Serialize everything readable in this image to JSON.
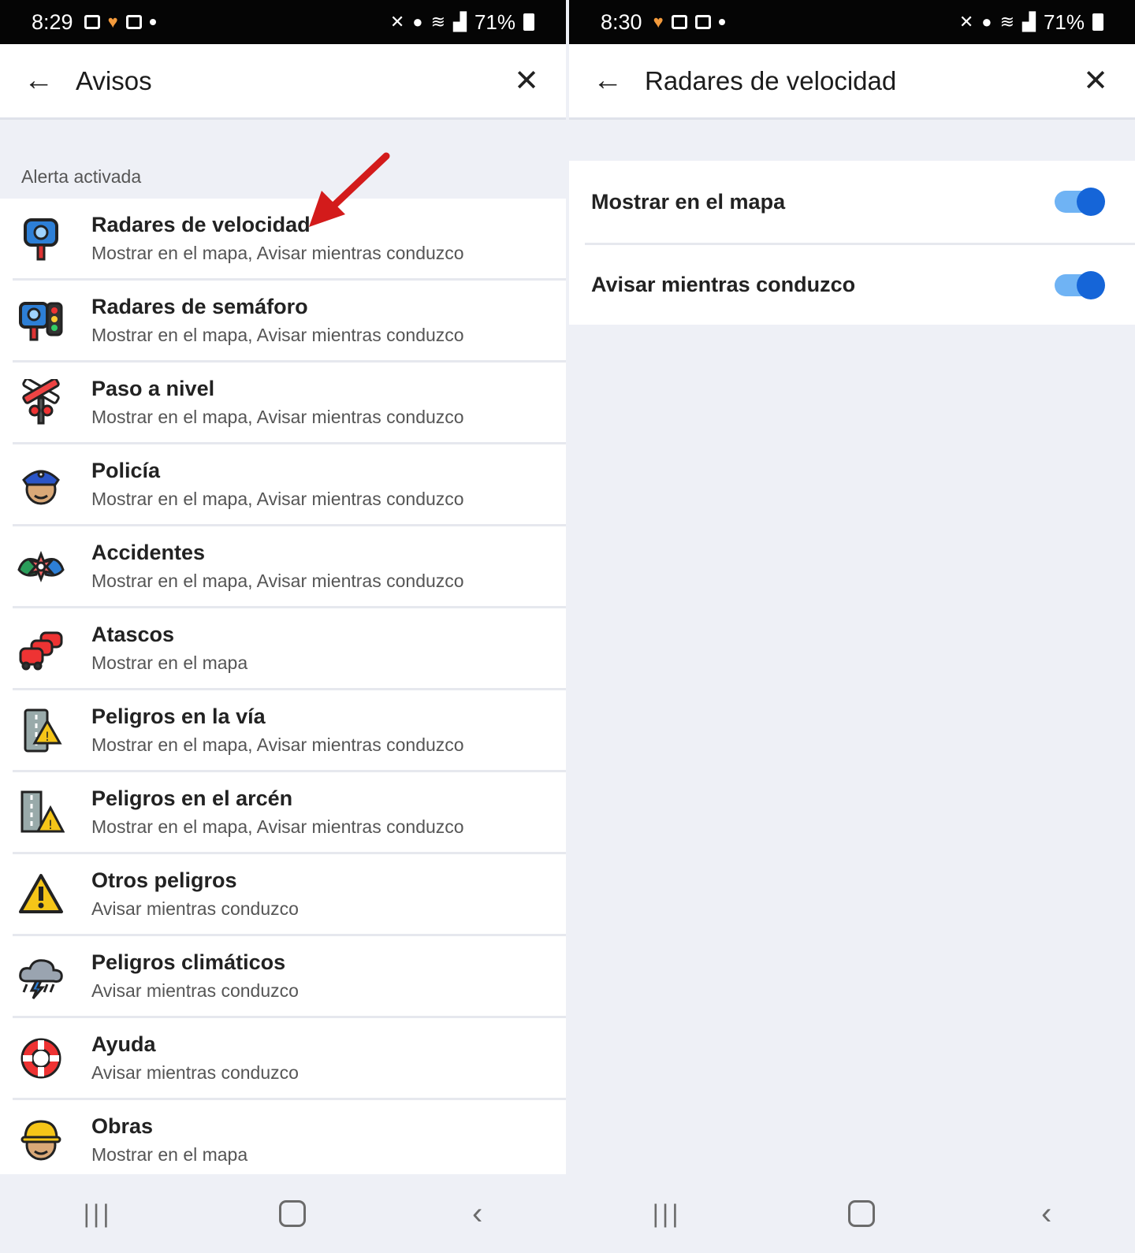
{
  "colors": {
    "toggle_on": "#1565d8",
    "toggle_track": "#6fb3f4",
    "arrow": "#d31b1b"
  },
  "left": {
    "status": {
      "time": "8:29",
      "battery": "71%"
    },
    "title": "Avisos",
    "section": "Alerta activada",
    "items": [
      {
        "name": "Radares de velocidad",
        "sub": "Mostrar en el mapa, Avisar mientras conduzco",
        "icon": "speed-camera-icon"
      },
      {
        "name": "Radares de semáforo",
        "sub": "Mostrar en el mapa, Avisar mientras conduzco",
        "icon": "traffic-light-camera-icon"
      },
      {
        "name": "Paso a nivel",
        "sub": "Mostrar en el mapa, Avisar mientras conduzco",
        "icon": "railroad-crossing-icon"
      },
      {
        "name": "Policía",
        "sub": "Mostrar en el mapa, Avisar mientras conduzco",
        "icon": "police-icon"
      },
      {
        "name": "Accidentes",
        "sub": "Mostrar en el mapa, Avisar mientras conduzco",
        "icon": "accident-icon"
      },
      {
        "name": "Atascos",
        "sub": "Mostrar en el mapa",
        "icon": "traffic-jam-icon"
      },
      {
        "name": "Peligros en la vía",
        "sub": "Mostrar en el mapa, Avisar mientras conduzco",
        "icon": "road-hazard-icon"
      },
      {
        "name": "Peligros en el arcén",
        "sub": "Mostrar en el mapa, Avisar mientras conduzco",
        "icon": "shoulder-hazard-icon"
      },
      {
        "name": "Otros peligros",
        "sub": "Avisar mientras conduzco",
        "icon": "warning-icon"
      },
      {
        "name": "Peligros climáticos",
        "sub": "Avisar mientras conduzco",
        "icon": "storm-icon"
      },
      {
        "name": "Ayuda",
        "sub": "Avisar mientras conduzco",
        "icon": "lifebuoy-icon"
      },
      {
        "name": "Obras",
        "sub": "Mostrar en el mapa",
        "icon": "construction-worker-icon"
      }
    ]
  },
  "right": {
    "status": {
      "time": "8:30",
      "battery": "71%"
    },
    "title": "Radares de velocidad",
    "toggles": [
      {
        "label": "Mostrar en el mapa",
        "on": true
      },
      {
        "label": "Avisar mientras conduzco",
        "on": true
      }
    ]
  }
}
